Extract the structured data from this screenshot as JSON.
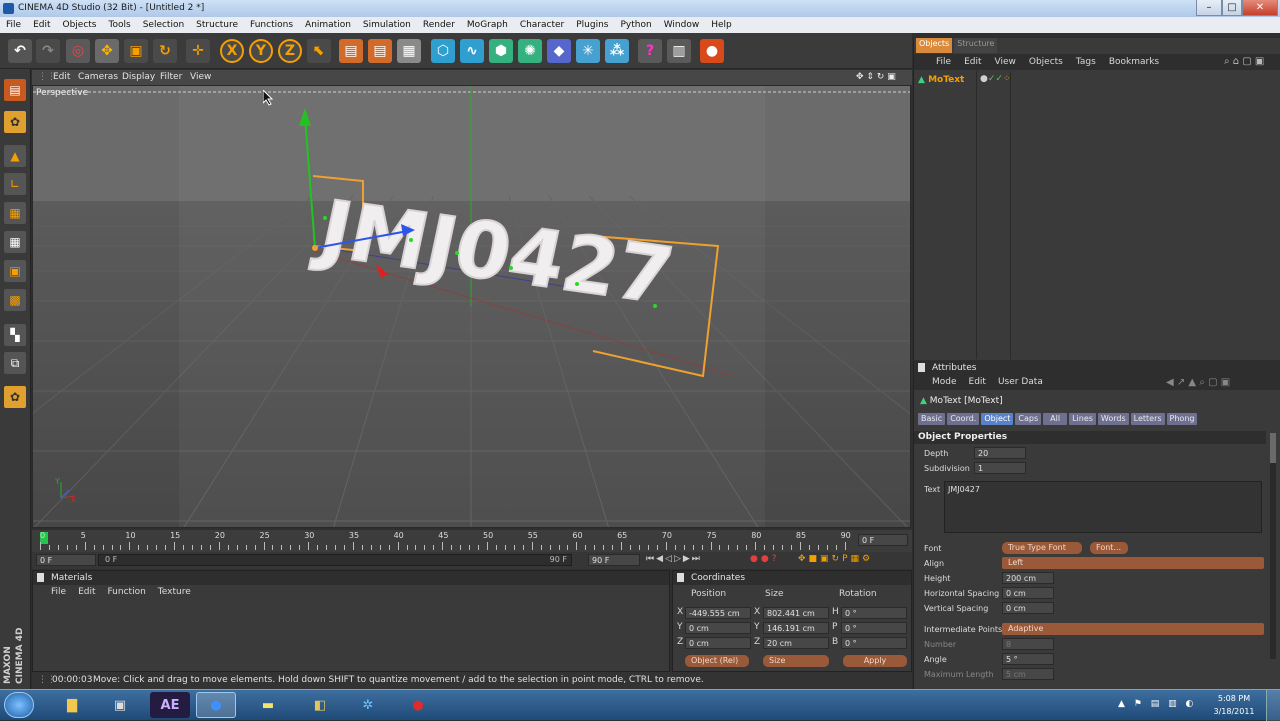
{
  "window": {
    "title": "CINEMA 4D Studio (32 Bit) - [Untitled 2 *]"
  },
  "menu": [
    "File",
    "Edit",
    "Objects",
    "Tools",
    "Selection",
    "Structure",
    "Functions",
    "Animation",
    "Simulation",
    "Render",
    "MoGraph",
    "Character",
    "Plugins",
    "Python",
    "Window",
    "Help"
  ],
  "viewport": {
    "menu": [
      "Edit",
      "Cameras",
      "Display",
      "Filter",
      "View"
    ],
    "label": "Perspective",
    "scene_text": "JMJ0427",
    "axis_y": "Y",
    "axis_x": "x"
  },
  "timeline": {
    "ticks": [
      "0",
      "5",
      "10",
      "15",
      "20",
      "25",
      "30",
      "35",
      "40",
      "45",
      "50",
      "55",
      "60",
      "65",
      "70",
      "75",
      "80",
      "85",
      "90"
    ],
    "frame_field": "0 F",
    "start_field": "0 F",
    "range_start": "0 F",
    "range_end": "90 F",
    "end_field": "90 F"
  },
  "materials": {
    "title": "Materials",
    "menu": [
      "File",
      "Edit",
      "Function",
      "Texture"
    ]
  },
  "coordinates": {
    "title": "Coordinates",
    "headers": [
      "Position",
      "Size",
      "Rotation"
    ],
    "rows": [
      {
        "axis": "X",
        "pos": "-449.555 cm",
        "size_axis": "X",
        "size": "802.441 cm",
        "rot_axis": "H",
        "rot": "0 °"
      },
      {
        "axis": "Y",
        "pos": "0 cm",
        "size_axis": "Y",
        "size": "146.191 cm",
        "rot_axis": "P",
        "rot": "0 °"
      },
      {
        "axis": "Z",
        "pos": "0 cm",
        "size_axis": "Z",
        "size": "20 cm",
        "rot_axis": "B",
        "rot": "0 °"
      }
    ],
    "mode": "Object (Rel)",
    "size_mode": "Size",
    "apply": "Apply"
  },
  "status": {
    "time": "00:00:03",
    "message": "Move: Click and drag to move elements. Hold down SHIFT to quantize movement / add to the selection in point mode, CTRL to remove."
  },
  "objects_panel": {
    "tabs": [
      "Objects",
      "Structure"
    ],
    "menu": [
      "File",
      "Edit",
      "View",
      "Objects",
      "Tags",
      "Bookmarks"
    ],
    "items": [
      {
        "name": "MoText"
      }
    ]
  },
  "attributes": {
    "title": "Attributes",
    "menu": [
      "Mode",
      "Edit",
      "User Data"
    ],
    "object_name": "MoText [MoText]",
    "tabs": [
      "Basic",
      "Coord.",
      "Object",
      "Caps",
      "All",
      "Lines",
      "Words",
      "Letters",
      "Phong"
    ],
    "section": "Object Properties",
    "depth_label": "Depth",
    "depth": "20",
    "subdivision_label": "Subdivision",
    "subdivision": "1",
    "text_label": "Text",
    "text_value": "JMJ0427",
    "font_label": "Font",
    "font_value": "True Type Font",
    "font_button": "Font...",
    "align_label": "Align",
    "align_value": "Left",
    "height_label": "Height",
    "height_value": "200 cm",
    "hspacing_label": "Horizontal Spacing",
    "hspacing_value": "0 cm",
    "vspacing_label": "Vertical Spacing",
    "vspacing_value": "0 cm",
    "ipoints_label": "Intermediate Points",
    "ipoints_value": "Adaptive",
    "number_label": "Number",
    "number_value": "8",
    "angle_label": "Angle",
    "angle_value": "5 °",
    "maxlen_label": "Maximum Length",
    "maxlen_value": "5 cm"
  },
  "side_logo": "MAXON CINEMA 4D",
  "taskbar": {
    "apps": [
      "folder",
      "terminal",
      "AE",
      "globe",
      "notes",
      "c4d",
      "network",
      "media"
    ],
    "time": "5:08 PM",
    "date": "3/18/2011"
  }
}
